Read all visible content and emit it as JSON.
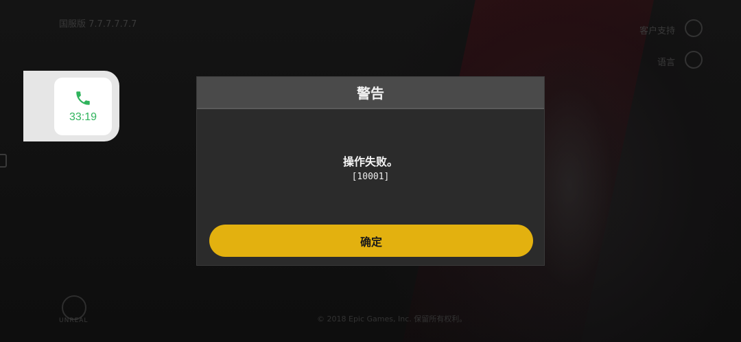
{
  "background": {
    "top_left_text": "国服版 7.7.7.7.7.7",
    "support_label": "客户支持",
    "language_label": "语言",
    "engine_logo_text": "UNREAL",
    "copyright": "© 2018 Epic Games, Inc. 保留所有权利。"
  },
  "call_widget": {
    "duration": "33:19",
    "icon": "phone-icon",
    "accent": "#2fb35c"
  },
  "dialog": {
    "title": "警告",
    "message": "操作失败。",
    "code": "[10001]",
    "confirm_label": "确定",
    "button_color": "#e3b10f"
  }
}
